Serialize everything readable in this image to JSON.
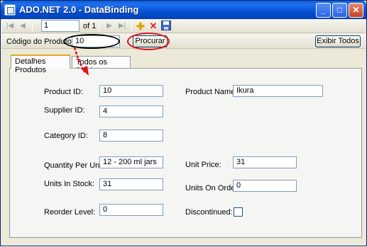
{
  "window": {
    "title": "ADO.NET 2.0 - DataBinding"
  },
  "navigator": {
    "position": "1",
    "of_label": "of 1"
  },
  "search": {
    "label": "Código do Produto ::",
    "value": "10",
    "search_button": "Procurar",
    "show_all_button": "Exibir Todos"
  },
  "tabs": [
    {
      "label": "Detalhes Produtos",
      "active": true
    },
    {
      "label": "Todos os Produtos",
      "active": false
    }
  ],
  "form": {
    "product_id": {
      "label": "Product ID:",
      "value": "10"
    },
    "product_name": {
      "label": "Product Name:",
      "value": "Ikura"
    },
    "supplier_id": {
      "label": "Supplier ID:",
      "value": "4"
    },
    "category_id": {
      "label": "Category ID:",
      "value": "8"
    },
    "quantity_per_unit": {
      "label": "Quantity Per Unit:",
      "value": "12 - 200 ml jars"
    },
    "unit_price": {
      "label": "Unit Price:",
      "value": "31"
    },
    "units_in_stock": {
      "label": "Units In Stock:",
      "value": "31"
    },
    "units_on_order": {
      "label": "Units On Order:",
      "value": "0"
    },
    "reorder_level": {
      "label": "Reorder Level:",
      "value": "0"
    },
    "discontinued": {
      "label": "Discontinued:",
      "checked": false
    }
  },
  "colors": {
    "annotation_red": "#e0101a",
    "title_blue": "#0550d2"
  }
}
